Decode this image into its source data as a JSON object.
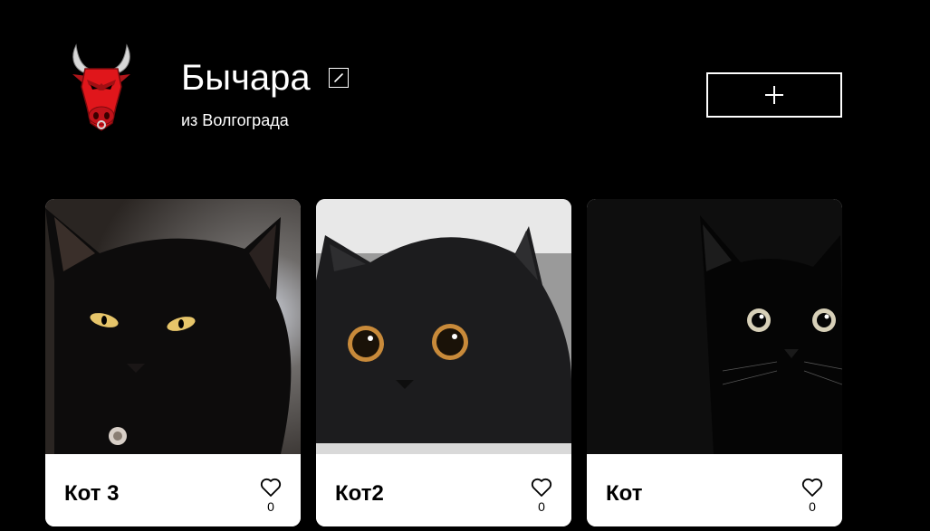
{
  "profile": {
    "name": "Бычара",
    "about": "из Волгограда",
    "avatar_icon": "bull-head-icon",
    "edit_icon": "pencil-icon",
    "add_icon": "plus-icon"
  },
  "colors": {
    "background": "#000000",
    "card": "#ffffff",
    "accent_red": "#e0161b"
  },
  "cards": [
    {
      "title": "Кот 3",
      "likes": "0",
      "icon": "heart-outline-icon"
    },
    {
      "title": "Кот2",
      "likes": "0",
      "icon": "heart-outline-icon"
    },
    {
      "title": "Кот",
      "likes": "0",
      "icon": "heart-outline-icon"
    }
  ]
}
